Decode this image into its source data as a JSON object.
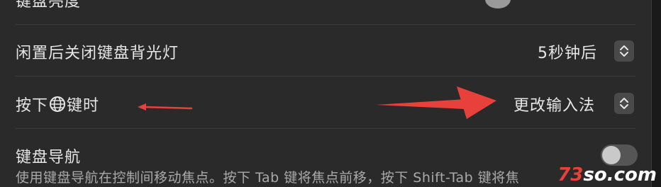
{
  "rows": {
    "partial_top": {
      "label": "键盘亮度"
    },
    "backlight_off": {
      "label": "闲置后关闭键盘背光灯",
      "value": "5秒钟后"
    },
    "globe_key": {
      "label_before": "按下",
      "label_after": "键时",
      "value": "更改输入法"
    },
    "keyboard_nav": {
      "label": "键盘导航",
      "description": "使用键盘导航在控制间移动焦点。按下 Tab 键将焦点前移，按下 Shift-Tab 键将焦"
    }
  },
  "watermark": {
    "prefix": "73",
    "suffix": "so.com"
  },
  "colors": {
    "annotation_arrow": "#e8413b",
    "panel": "#2a2a2a"
  },
  "icons": [
    "globe-icon",
    "stepper-chevrons-icon",
    "toggle-switch",
    "arrow-annotation"
  ],
  "toggle_state": {
    "keyboard_nav": "off"
  }
}
